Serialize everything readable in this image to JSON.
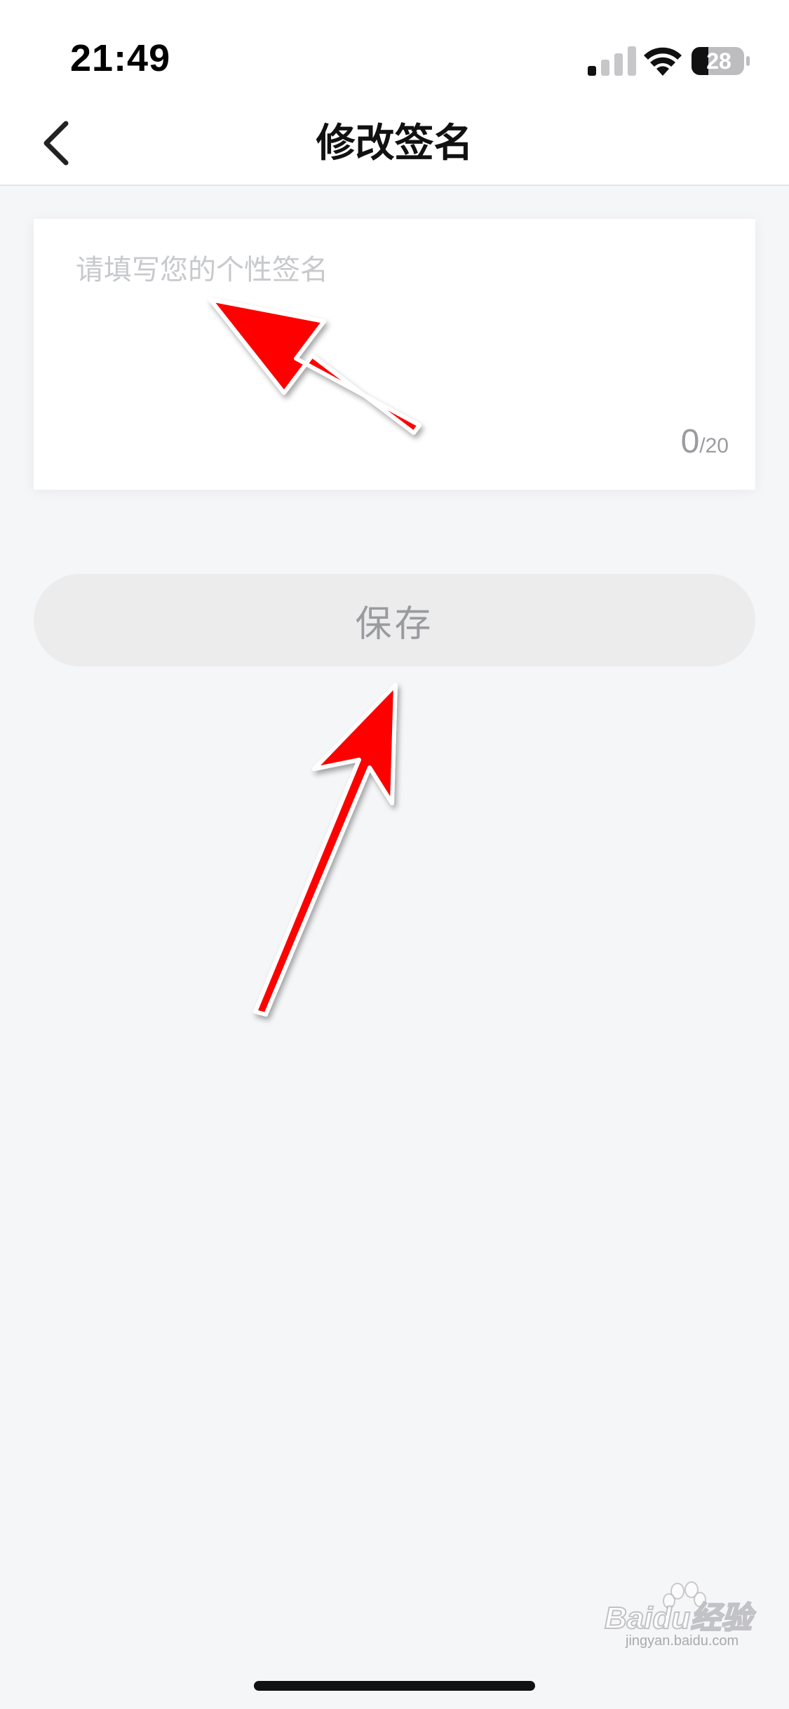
{
  "status_bar": {
    "time": "21:49",
    "battery_level": "28",
    "icons": [
      "signal-icon",
      "wifi-icon",
      "battery-icon"
    ]
  },
  "header": {
    "back_icon": "chevron-left-icon",
    "title": "修改签名"
  },
  "signature_form": {
    "input_value": "",
    "placeholder": "请填写您的个性签名",
    "char_count": "0",
    "char_limit": "/20"
  },
  "actions": {
    "save_label": "保存"
  },
  "annotations": {
    "arrow_color": "#ff0000",
    "count": 2
  },
  "watermark": {
    "brand": "Baidu经验",
    "url": "jingyan.baidu.com"
  },
  "colors": {
    "page_background": "#f5f6f8",
    "card_background": "#ffffff",
    "button_background": "#ececed",
    "button_text": "#9a9b9e",
    "placeholder_text": "#c8c9cc"
  }
}
